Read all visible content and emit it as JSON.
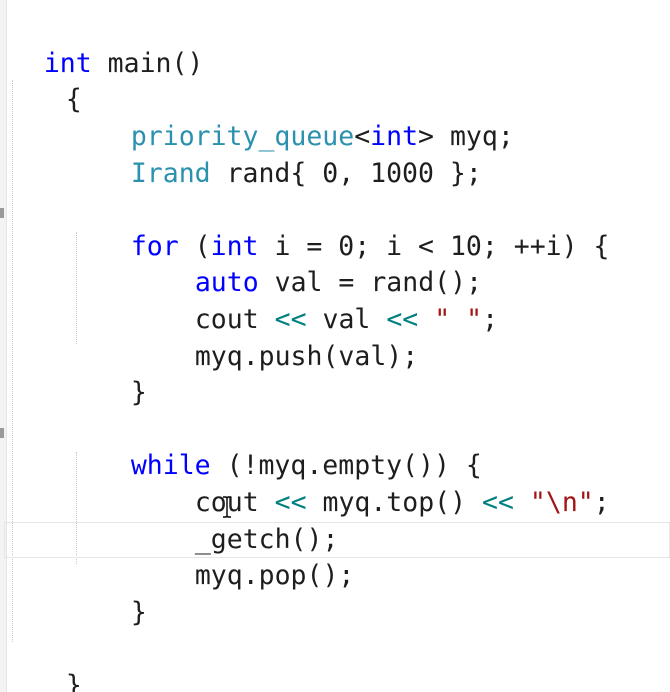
{
  "editor": {
    "colors": {
      "keyword": "#0000ff",
      "type": "#2b91af",
      "string": "#a31515",
      "operator": "#008080",
      "text": "#1e1e1e"
    },
    "cursor_icon": "i-beam-cursor-icon"
  },
  "code": {
    "l1": {
      "kw": "int",
      "rest": " main()"
    },
    "l2": {
      "t": "{"
    },
    "l3": {
      "ty": "priority_queue",
      "p1": "<",
      "kw": "int",
      "p2": "> myq;"
    },
    "l4": {
      "ty": "Irand",
      "p1": " rand{ 0, 1000 };"
    },
    "l6": {
      "kw1": "for",
      "p1": " (",
      "kw2": "int",
      "p2": " i = 0; i < 10; ++i) {"
    },
    "l7": {
      "kw": "auto",
      "p1": " val = rand();"
    },
    "l8": {
      "p1": "cout ",
      "op1": "<<",
      "p2": " val ",
      "op2": "<<",
      "p3": " ",
      "str": "\" \"",
      "p4": ";"
    },
    "l9": {
      "t": "myq.push(val);"
    },
    "l10": {
      "t": "}"
    },
    "l12": {
      "kw": "while",
      "p1": " (!myq.empty()) {"
    },
    "l13": {
      "p1": "cout ",
      "op1": "<<",
      "p2": " myq.top() ",
      "op2": "<<",
      "p3": " ",
      "str": "\"\\n\"",
      "p4": ";"
    },
    "l14": {
      "t": "_getch();"
    },
    "l15": {
      "t": "myq.pop();"
    },
    "l16": {
      "t": "}"
    },
    "l18": {
      "t": "}"
    }
  }
}
